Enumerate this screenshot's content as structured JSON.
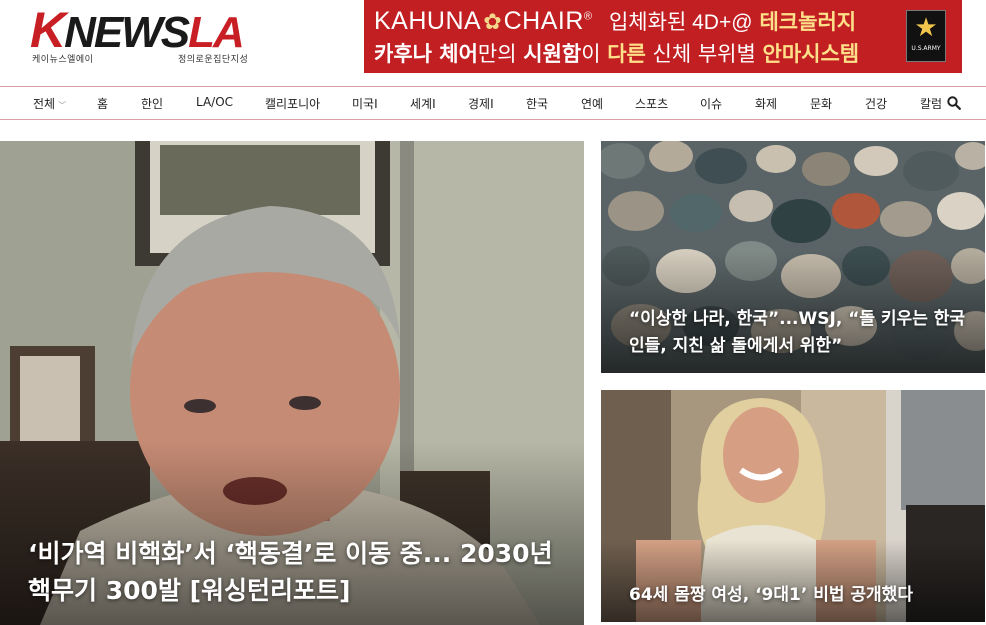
{
  "logo": {
    "main_k": "K",
    "main_news": "NEWS",
    "main_la": "LA",
    "sub_left": "케이뉴스엘에이",
    "sub_right": "정의로운집단지성"
  },
  "ad": {
    "brand": "KAHUNA",
    "brand2": "CHAIR",
    "reg": "®",
    "line1_white": "입체화된 4D+@",
    "line1_yellow": "테크놀러지",
    "line2_part1": "카후나 체어",
    "line2_part2": "만의 ",
    "line2_part3": "시원함",
    "line2_part4": "이 ",
    "line2_part5": "다른",
    "line2_part6": " 신체 부위별 ",
    "line2_part7": "안마시스템",
    "army_label": "U.S.ARMY"
  },
  "nav": {
    "items": [
      "전체",
      "홈",
      "한인",
      "LA/OC",
      "캘리포니아",
      "미국I",
      "세계I",
      "경제I",
      "한국",
      "연예",
      "스포츠",
      "이슈",
      "화제",
      "문화",
      "건강",
      "칼럼"
    ],
    "chevron": "﹀"
  },
  "articles": {
    "main": {
      "title": "‘비가역 비핵화’서 ‘핵동결’로 이동 중... 2030년 핵무기 300발 [워싱턴리포트]"
    },
    "top_right": {
      "title": "“이상한 나라, 한국”...WSJ, “돌 키우는 한국인들, 지친 삶 돌에게서 위한”"
    },
    "bottom_right": {
      "title": "64세 몸짱 여성, ‘9대1’ 비법 공개했다"
    }
  },
  "colors": {
    "brand_red": "#c81f24",
    "ad_red": "#c11f22",
    "nav_border": "#d8a0a3"
  },
  "icons": {
    "search": "search-icon",
    "army": "army-star-icon",
    "flower": "flower-icon"
  }
}
